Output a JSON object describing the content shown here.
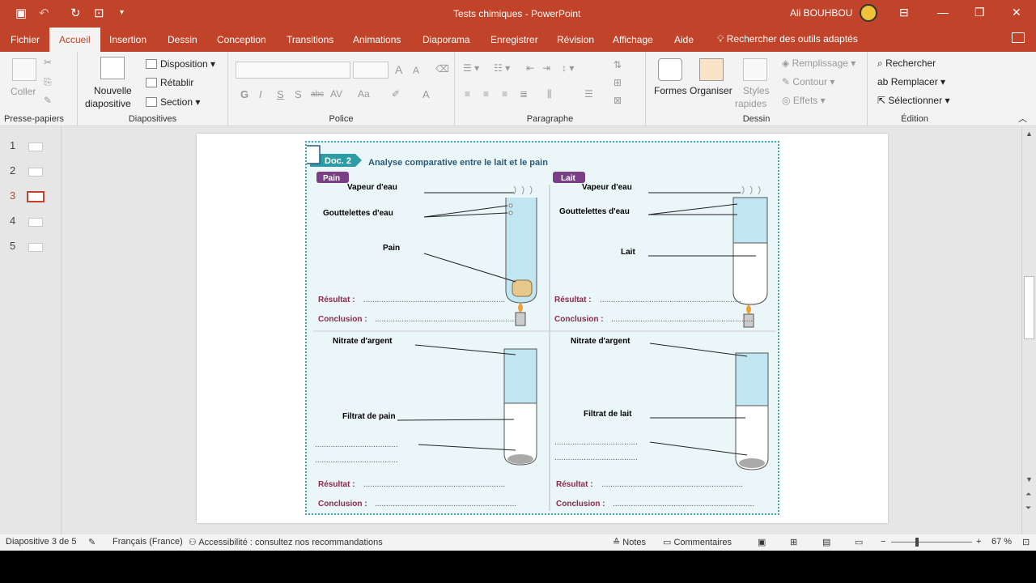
{
  "app": {
    "window_title": "Tests chimiques - PowerPoint",
    "user_name": "Ali BOUHBOU"
  },
  "tabs": [
    {
      "label": "Fichier"
    },
    {
      "label": "Accueil"
    },
    {
      "label": "Insertion"
    },
    {
      "label": "Dessin"
    },
    {
      "label": "Conception"
    },
    {
      "label": "Transitions"
    },
    {
      "label": "Animations"
    },
    {
      "label": "Diaporama"
    },
    {
      "label": "Enregistrer"
    },
    {
      "label": "Révision"
    },
    {
      "label": "Affichage"
    },
    {
      "label": "Aide"
    }
  ],
  "search": {
    "label": "Rechercher des outils adaptés"
  },
  "ribbon": {
    "clipboard": {
      "label": "Presse-papiers",
      "paste": "Coller"
    },
    "slides": {
      "label": "Diapositives",
      "new_slide_1": "Nouvelle",
      "new_slide_2": "diapositive",
      "layout": "Disposition",
      "reset": "Rétablir",
      "section": "Section"
    },
    "font": {
      "label": "Police",
      "bold": "G",
      "italic": "I",
      "underline": "S",
      "shadow": "S",
      "strike": "abc",
      "spacing": "AV",
      "case": "Aa",
      "grow": "A",
      "shrink": "A",
      "color": "A"
    },
    "paragraph": {
      "label": "Paragraphe"
    },
    "drawing": {
      "label": "Dessin",
      "shapes": "Formes",
      "arrange": "Organiser",
      "styles_1": "Styles",
      "styles_2": "rapides",
      "fill": "Remplissage",
      "outline": "Contour",
      "effects": "Effets"
    },
    "editing": {
      "label": "Édition",
      "find": "Rechercher",
      "replace": "Remplacer",
      "select": "Sélectionner"
    }
  },
  "thumbnails": [
    {
      "num": "1"
    },
    {
      "num": "2"
    },
    {
      "num": "3"
    },
    {
      "num": "4"
    },
    {
      "num": "5"
    }
  ],
  "slide": {
    "doc_badge": "Doc. 2",
    "doc_title": "Analyse comparative entre le lait et le pain",
    "pain_tag": "Pain",
    "lait_tag": "Lait",
    "vapeur": "Vapeur d'eau",
    "gouttelettes": "Gouttelettes d'eau",
    "pain_label": "Pain",
    "lait_label": "Lait",
    "resultat": "Résultat :",
    "conclusion": "Conclusion :",
    "nitrate": "Nitrate d'argent",
    "filtrat_pain": "Filtrat de pain",
    "filtrat_lait": "Filtrat de lait",
    "dots_long": "...............................................................",
    "dots_short": "....................................."
  },
  "status": {
    "slide_info": "Diapositive 3 de 5",
    "language": "Français (France)",
    "accessibility": "Accessibilité : consultez nos recommandations",
    "notes": "Notes",
    "comments": "Commentaires",
    "zoom": "67 %"
  }
}
